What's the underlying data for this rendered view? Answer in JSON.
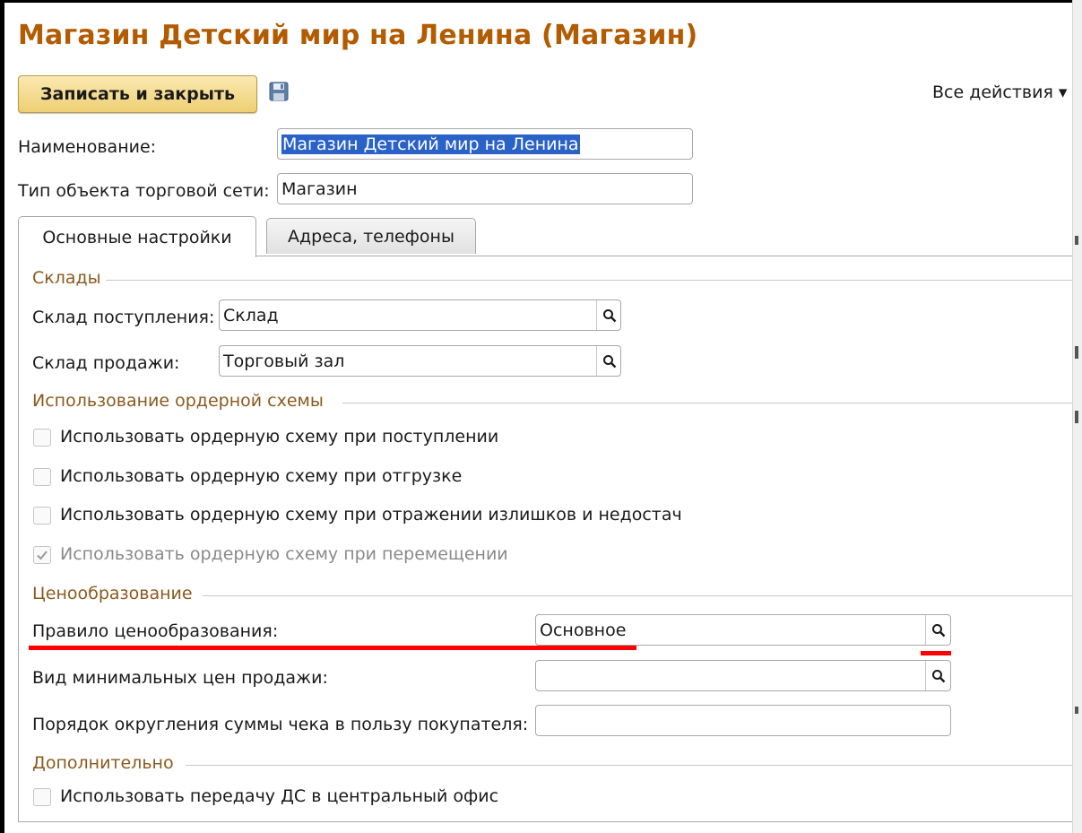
{
  "window": {
    "title": "Магазин Детский мир на Ленина (Магазин)"
  },
  "toolbar": {
    "save_close_label": "Записать и закрыть",
    "all_actions_label": "Все действия ▾"
  },
  "fields": {
    "name_label": "Наименование:",
    "name_value": "Магазин Детский мир на Ленина",
    "type_label": "Тип объекта торговой сети:",
    "type_value": "Магазин"
  },
  "tabs": [
    {
      "label": "Основные настройки",
      "active": true
    },
    {
      "label": "Адреса, телефоны",
      "active": false
    }
  ],
  "warehouses": {
    "group_title": "Склады",
    "receipt_label": "Склад поступления:",
    "receipt_value": "Склад",
    "sale_label": "Склад продажи:",
    "sale_value": "Торговый зал"
  },
  "order_scheme": {
    "group_title": "Использование ордерной схемы",
    "options": [
      {
        "label": "Использовать ордерную схему при поступлении",
        "checked": false,
        "disabled": false
      },
      {
        "label": "Использовать ордерную схему при отгрузке",
        "checked": false,
        "disabled": false
      },
      {
        "label": "Использовать ордерную схему при отражении излишков и недостач",
        "checked": false,
        "disabled": false
      },
      {
        "label": "Использовать ордерную схему при перемещении",
        "checked": true,
        "disabled": true
      }
    ]
  },
  "pricing": {
    "group_title": "Ценообразование",
    "rule_label": "Правило ценообразования:",
    "rule_value": "Основное",
    "min_price_label": "Вид минимальных цен продажи:",
    "min_price_value": "",
    "rounding_label": "Порядок округления суммы чека в пользу покупателя:",
    "rounding_value": ""
  },
  "additional": {
    "group_title": "Дополнительно",
    "option_label": "Использовать передачу ДС в центральный офис",
    "option_checked": false
  },
  "colors": {
    "title": "#b35b00",
    "group_title": "#8a5a1e",
    "selection": "#2a62c8",
    "button": "#eecf73",
    "annotation": "#ff0000"
  }
}
